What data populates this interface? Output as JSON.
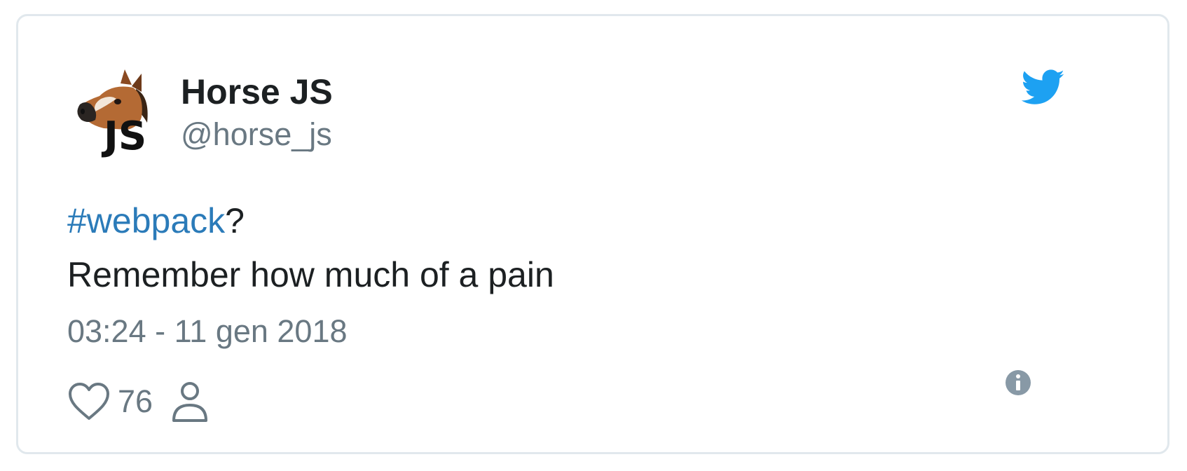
{
  "tweet": {
    "author_name": "Horse JS",
    "author_handle": "@horse_js",
    "avatar_icon": "horse-js-avatar",
    "brand_icon": "twitter-bird-icon",
    "hashtag": "#webpack",
    "hashtag_suffix": "?",
    "text_line": "Remember how much of a pain",
    "timestamp": "03:24 - 11 gen 2018",
    "like_count": "76",
    "colors": {
      "brand": "#1da1f2",
      "link": "#2b7bb9",
      "text": "#1c2022",
      "muted": "#697882",
      "border": "#e1e8ed"
    }
  }
}
